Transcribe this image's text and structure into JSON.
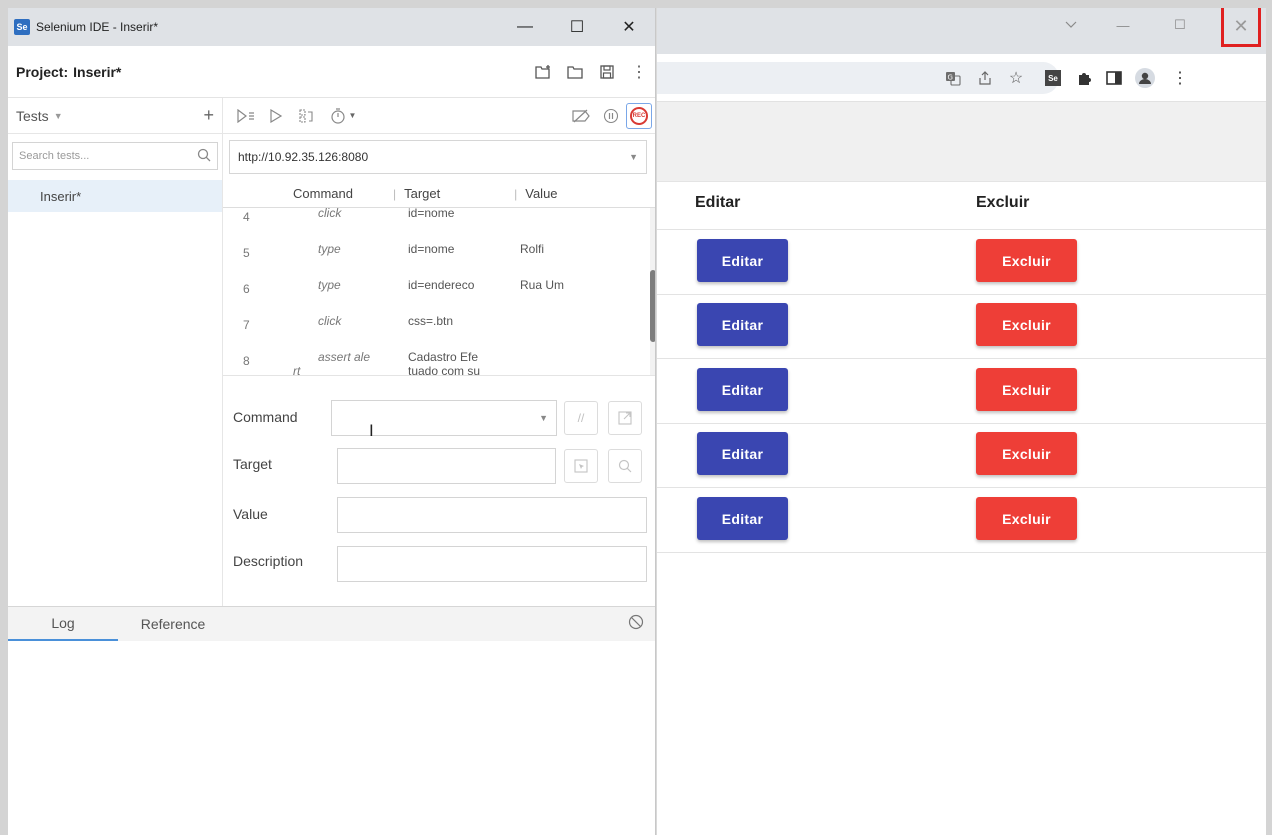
{
  "ide": {
    "title": "Selenium IDE - Inserir*",
    "logo_text": "Se",
    "window_controls": {
      "minimize": "—",
      "maximize": "☐",
      "close": "✕"
    },
    "project_label": "Project:",
    "project_name": "Inserir*",
    "tests_label": "Tests",
    "search_placeholder": "Search tests...",
    "test_items": [
      "Inserir*"
    ],
    "base_url": "http://10.92.35.126:8080",
    "grid": {
      "headers": {
        "command": "Command",
        "target": "Target",
        "value": "Value"
      },
      "rows": [
        {
          "num": "4",
          "command": "click",
          "target": "id=nome",
          "value": ""
        },
        {
          "num": "5",
          "command": "type",
          "target": "id=nome",
          "value": "Rolfi"
        },
        {
          "num": "6",
          "command": "type",
          "target": "id=endereco",
          "value": "Rua Um"
        },
        {
          "num": "7",
          "command": "click",
          "target": "css=.btn",
          "value": ""
        },
        {
          "num": "8",
          "command": "assert ale",
          "target": "Cadastro Efe",
          "value": ""
        }
      ],
      "row8_cmd_wrap": "rt",
      "row8_tgt_wrap": "tuado com su"
    },
    "form": {
      "command_label": "Command",
      "target_label": "Target",
      "value_label": "Value",
      "description_label": "Description",
      "command_value": "",
      "target_value": "",
      "value_value": "",
      "description_value": ""
    },
    "bottom_tabs": {
      "log": "Log",
      "reference": "Reference"
    }
  },
  "browser": {
    "table": {
      "headers": {
        "edit": "Editar",
        "delete": "Excluir"
      },
      "rows": [
        {
          "edit": "Editar",
          "delete": "Excluir"
        },
        {
          "edit": "Editar",
          "delete": "Excluir"
        },
        {
          "edit": "Editar",
          "delete": "Excluir"
        },
        {
          "edit": "Editar",
          "delete": "Excluir"
        },
        {
          "edit": "Editar",
          "delete": "Excluir"
        }
      ]
    },
    "colors": {
      "edit_button": "#3a46b1",
      "delete_button": "#ee3e37",
      "close_highlight": "#e02020"
    }
  }
}
